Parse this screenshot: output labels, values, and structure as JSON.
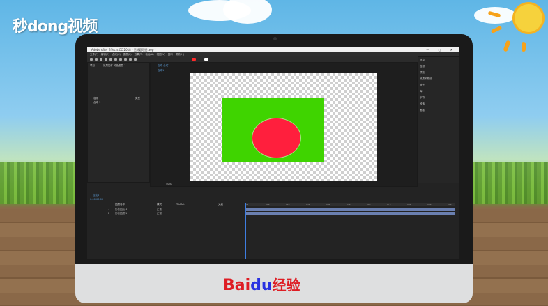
{
  "branding": {
    "top_logo": "秒dong视频",
    "baidu_part1": "Bai",
    "baidu_paw": "du",
    "baidu_part2": "经验"
  },
  "app": {
    "window_title": "Adobe After Effects CC 2018 - 无标题项目.aep *",
    "window_controls": "—  ▢  ✕",
    "menus": [
      "文件(F)",
      "编辑(E)",
      "合成(C)",
      "图层(L)",
      "效果(T)",
      "动画(A)",
      "视图(V)",
      "窗口",
      "帮助(H)"
    ],
    "project_tab": "项目",
    "effects_tab": "效果控件 纯色图层 1",
    "comp_tab": "合成 合成1",
    "comp_subtab": "合成1",
    "project_cols": [
      "名称",
      "类型"
    ],
    "project_item": "合成 1",
    "viewer_zoom": "50%",
    "timeline_tab": "合成1",
    "timecode": "0:00:00:00",
    "timeline_layers": [
      {
        "num": "1",
        "name": "形状图层 1",
        "mode": "正常"
      },
      {
        "num": "2",
        "name": "形状图层 1",
        "mode": "正常"
      }
    ],
    "timeline_cols": [
      "图层名称",
      "模式",
      "TrkMat",
      "父级"
    ],
    "ruler_ticks": [
      "0s",
      "01s",
      "02s",
      "03s",
      "04s",
      "05s",
      "06s",
      "07s",
      "08s",
      "09s",
      "10s"
    ],
    "right_panel": [
      "信息",
      "音频",
      "预览",
      "效果和预设",
      "对齐",
      "库",
      "字符",
      "段落",
      "画笔"
    ],
    "colors": {
      "green": "#3fd400",
      "red": "#ff1f3d",
      "accent": "#3e7de0"
    }
  }
}
